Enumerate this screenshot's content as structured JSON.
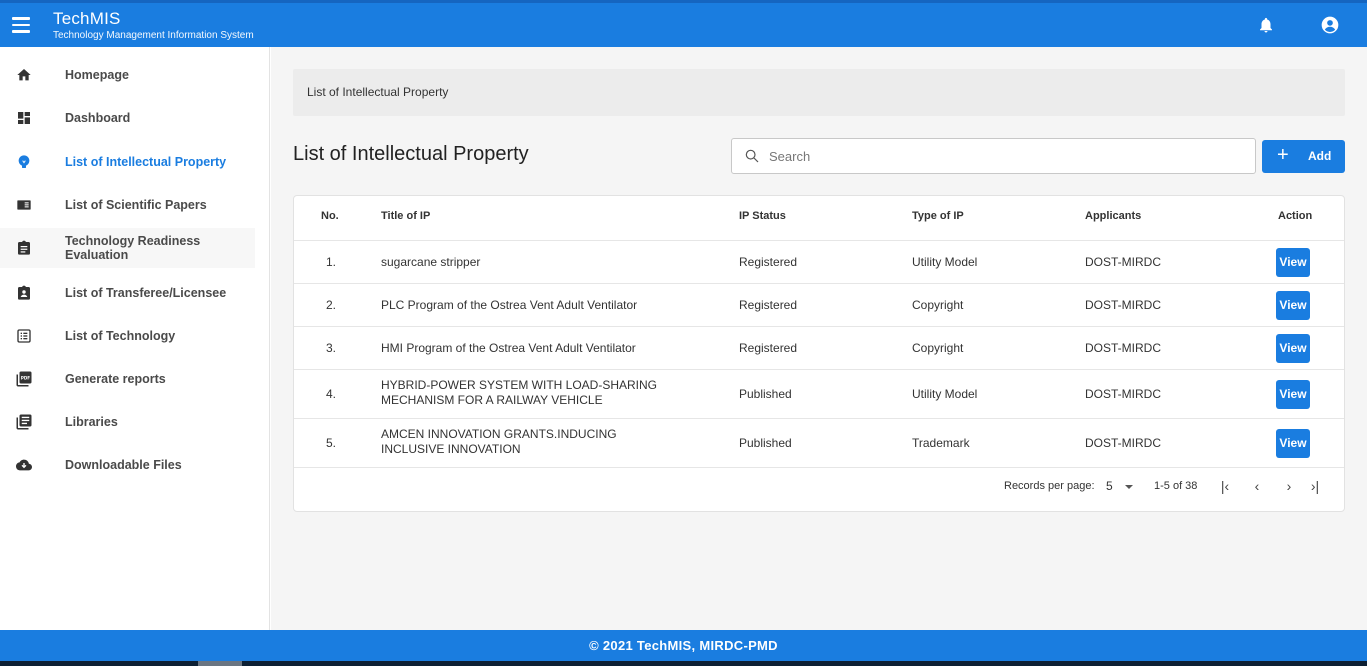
{
  "header": {
    "app_title": "TechMIS",
    "app_subtitle": "Technology Management Information System",
    "icons": [
      "menu-icon",
      "bell-icon",
      "user-circle-icon"
    ]
  },
  "sidebar": {
    "items": [
      {
        "label": "Homepage",
        "icon": "home-icon"
      },
      {
        "label": "Dashboard",
        "icon": "dashboard-icon"
      },
      {
        "label": "List of Intellectual Property",
        "icon": "lightbulb-icon",
        "active": true
      },
      {
        "label": "List of Scientific Papers",
        "icon": "book-icon"
      },
      {
        "label": "Technology Readiness Evaluation",
        "icon": "clipboard-icon"
      },
      {
        "label": "List of Transferee/Licensee",
        "icon": "clipboard-user-icon"
      },
      {
        "label": "List of Technology",
        "icon": "list-box-icon"
      },
      {
        "label": "Generate reports",
        "icon": "pdf-icon"
      },
      {
        "label": "Libraries",
        "icon": "library-icon"
      },
      {
        "label": "Downloadable Files",
        "icon": "cloud-download-icon"
      }
    ],
    "active_color": "#1a7de0"
  },
  "main": {
    "breadcrumb": "List of Intellectual Property",
    "page_title": "List of Intellectual Property",
    "search_placeholder": "Search",
    "add_label": "Add",
    "table": {
      "columns": [
        "No.",
        "Title of IP",
        "IP Status",
        "Type of IP",
        "Applicants",
        "Action"
      ],
      "rows": [
        {
          "no": "1.",
          "title": "sugarcane stripper",
          "status": "Registered",
          "type": "Utility Model",
          "applicants": "DOST-MIRDC",
          "action": "View"
        },
        {
          "no": "2.",
          "title": "PLC Program of the Ostrea Vent Adult Ventilator",
          "status": "Registered",
          "type": "Copyright",
          "applicants": "DOST-MIRDC",
          "action": "View"
        },
        {
          "no": "3.",
          "title": "HMI Program of the Ostrea Vent Adult Ventilator",
          "status": "Registered",
          "type": "Copyright",
          "applicants": "DOST-MIRDC",
          "action": "View"
        },
        {
          "no": "4.",
          "title": "HYBRID-POWER SYSTEM WITH LOAD-SHARING MECHANISM FOR A RAILWAY VEHICLE",
          "status": "Published",
          "type": "Utility Model",
          "applicants": "DOST-MIRDC",
          "action": "View"
        },
        {
          "no": "5.",
          "title": "AMCEN INNOVATION GRANTS.INDUCING INCLUSIVE INNOVATION",
          "status": "Published",
          "type": "Trademark",
          "applicants": "DOST-MIRDC",
          "action": "View"
        }
      ]
    },
    "pagination": {
      "records_per_page_label": "Records per page:",
      "records_per_page": "5",
      "range": "1-5 of 38"
    }
  },
  "footer": {
    "text": "© 2021 TechMIS, MIRDC-PMD"
  },
  "colors": {
    "primary": "#1a7de0",
    "sidebar_text": "#4a4a4a",
    "content_bg": "#f5f5f5"
  }
}
